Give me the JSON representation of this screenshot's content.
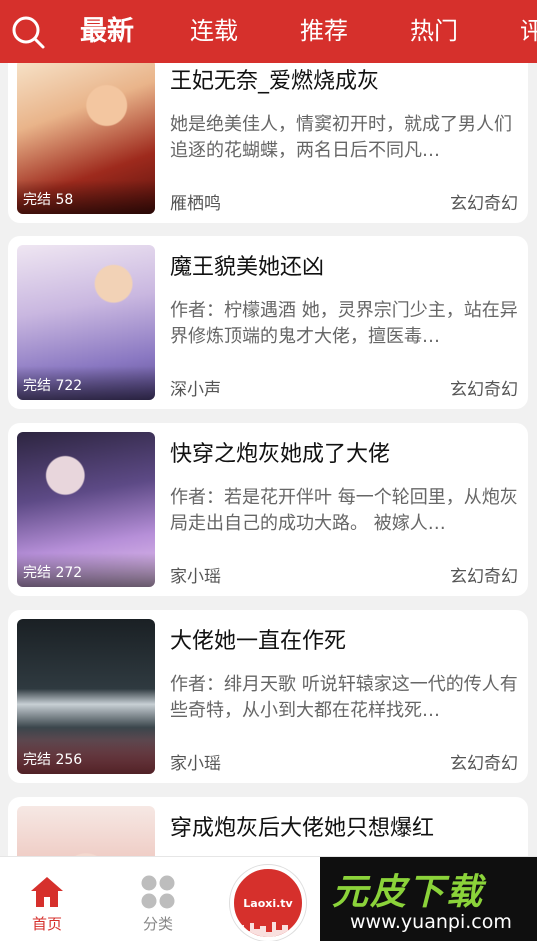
{
  "header": {
    "tabs": [
      {
        "label": "最新",
        "active": true
      },
      {
        "label": "连载",
        "active": false
      },
      {
        "label": "推荐",
        "active": false
      },
      {
        "label": "热门",
        "active": false
      },
      {
        "label": "评",
        "active": false
      }
    ]
  },
  "books": [
    {
      "title": "王妃无奈_爱燃烧成灰",
      "desc": "她是绝美佳人，情窦初开时，就成了男人们追逐的花蝴蝶，两名日后不同凡…",
      "author": "雁栖鸣",
      "genre": "玄幻奇幻",
      "status": "完结 58"
    },
    {
      "title": "魔王貌美她还凶",
      "desc": "作者：柠檬遇酒 她，灵界宗门少主，站在异界修炼顶端的鬼才大佬，擅医毒…",
      "author": "深小声",
      "genre": "玄幻奇幻",
      "status": "完结 722"
    },
    {
      "title": "快穿之炮灰她成了大佬",
      "desc": "作者：若是花开伴叶 每一个轮回里，从炮灰局走出自己的成功大路。 被嫁人…",
      "author": "家小瑶",
      "genre": "玄幻奇幻",
      "status": "完结 272"
    },
    {
      "title": "大佬她一直在作死",
      "desc": "作者：绯月天歌 听说轩辕家这一代的传人有些奇特，从小到大都在花样找死…",
      "author": "家小瑶",
      "genre": "玄幻奇幻",
      "status": "完结 256"
    },
    {
      "title": "穿成炮灰后大佬她只想爆红",
      "desc": "",
      "author": "",
      "genre": "",
      "status": ""
    }
  ],
  "bottom_nav": {
    "home_label": "首页",
    "category_label": "分类",
    "center_logo_text": "Laoxi.tv"
  },
  "watermark": {
    "big": "元皮下载",
    "small": "www.yuanpi.com"
  },
  "colors": {
    "brand_red": "#d6302c",
    "watermark_green": "#8bd33a"
  },
  "icons": [
    "search-icon",
    "home-icon",
    "category-grid-icon"
  ]
}
